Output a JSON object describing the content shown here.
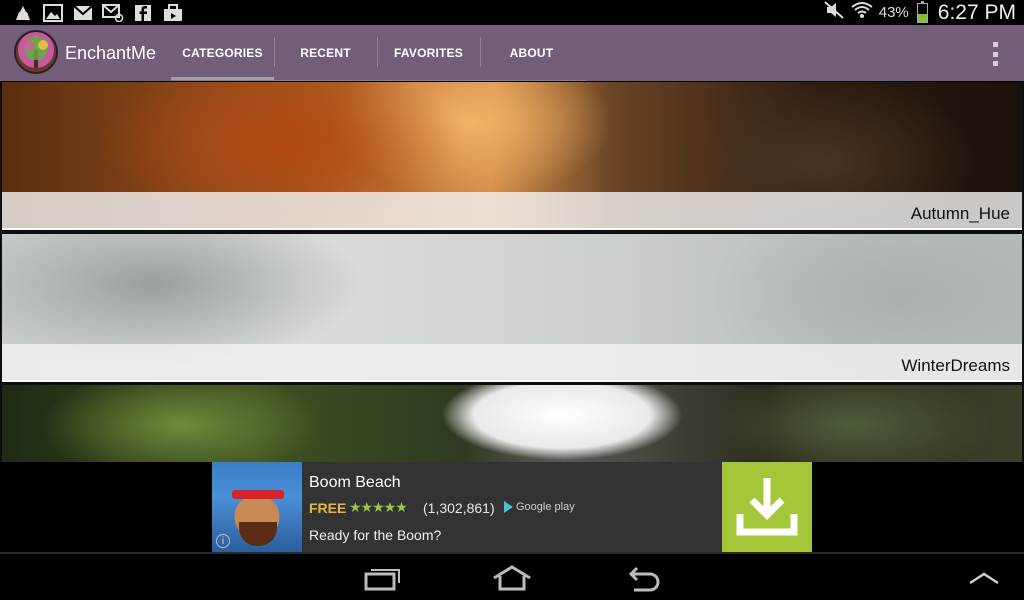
{
  "status_bar": {
    "battery_percent": "43%",
    "battery_level": 0.43,
    "time": "6:27 PM",
    "left_icons": [
      "app-icon",
      "image-icon",
      "gmail-icon",
      "email-icon",
      "facebook-icon",
      "briefcase-icon"
    ],
    "right_icons": [
      "mute-icon",
      "wifi-icon",
      "battery-icon"
    ]
  },
  "action_bar": {
    "app_title": "EnchantMe",
    "tabs": [
      {
        "label": "CATEGORIES",
        "active": true
      },
      {
        "label": "RECENT",
        "active": false
      },
      {
        "label": "FAVORITES",
        "active": false
      },
      {
        "label": "ABOUT",
        "active": false
      }
    ],
    "colors": {
      "bar": "#735e79",
      "indicator": "#a69aa9"
    }
  },
  "categories": [
    {
      "label": "Autumn_Hue"
    },
    {
      "label": "WinterDreams"
    },
    {
      "label": ""
    }
  ],
  "ad": {
    "title": "Boom Beach",
    "price": "FREE",
    "rating": 4.5,
    "stars": "★★★★★",
    "reviews": "(1,302,861)",
    "store": "Google play",
    "tagline": "Ready for the Boom?",
    "info_icon": "i",
    "colors": {
      "price": "#e8b936",
      "download": "#a4c639"
    }
  },
  "nav_bar": {
    "buttons": [
      "recent-apps-icon",
      "home-icon",
      "back-icon",
      "chevron-up-icon"
    ]
  }
}
